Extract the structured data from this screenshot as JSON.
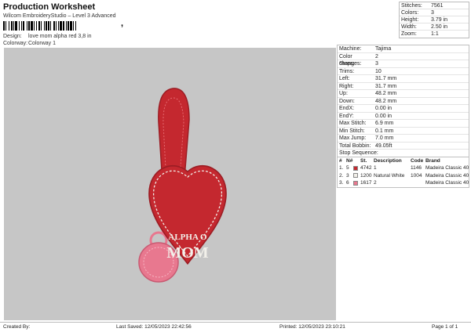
{
  "header": {
    "title": "Production Worksheet",
    "subtitle": "Wilcom EmbroideryStudio – Level 3 Advanced",
    "barcode_suffix": ","
  },
  "meta": [
    {
      "label": "Design:",
      "value": "love mom alpha red 3,8 in"
    },
    {
      "label": "Colorway:",
      "value": "Colorway 1"
    }
  ],
  "summary": [
    {
      "label": "Stitches:",
      "value": "7561"
    },
    {
      "label": "Colors:",
      "value": "3"
    },
    {
      "label": "Height:",
      "value": "3.79 in"
    },
    {
      "label": "Width:",
      "value": "2.50 in"
    },
    {
      "label": "Zoom:",
      "value": "1:1"
    }
  ],
  "machine_info": [
    {
      "label": "Machine:",
      "value": "Tajima"
    },
    {
      "label": "Color changes:",
      "value": "2"
    },
    {
      "label": "Stops:",
      "value": "3"
    },
    {
      "label": "Trims:",
      "value": "10"
    },
    {
      "label": "Left:",
      "value": "31.7 mm"
    },
    {
      "label": "Right:",
      "value": "31.7 mm"
    },
    {
      "label": "Up:",
      "value": "48.2 mm"
    },
    {
      "label": "Down:",
      "value": "48.2 mm"
    },
    {
      "label": "EndX:",
      "value": "0.00 in"
    },
    {
      "label": "EndY:",
      "value": "0.00 in"
    },
    {
      "label": "Max Stitch:",
      "value": "6.9 mm"
    },
    {
      "label": "Min Stitch:",
      "value": "0.1 mm"
    },
    {
      "label": "Max Jump:",
      "value": "7.0 mm"
    },
    {
      "label": "Total Bobbin:",
      "value": "49.05ft"
    }
  ],
  "stop_sequence": {
    "label": "Stop Sequence:",
    "headers": {
      "num": "#",
      "n": "N#",
      "st": "St.",
      "desc": "Description",
      "code": "Code",
      "brand": "Brand"
    },
    "rows": [
      {
        "num": "1.",
        "n": "5",
        "color": "#c4282f",
        "st": "4742",
        "desc": "1",
        "code": "1146",
        "brand": "Madeira Classic 40"
      },
      {
        "num": "2.",
        "n": "3",
        "color": "#f2f0ea",
        "st": "1200",
        "desc": "Natural White",
        "code": "1004",
        "brand": "Madeira Classic 40"
      },
      {
        "num": "3.",
        "n": "6",
        "color": "#e8788f",
        "st": "1617",
        "desc": "2",
        "code": "",
        "brand": "Madeira Classic 40"
      }
    ]
  },
  "design_text": {
    "line1": "ALPHA O",
    "line2": "MOM"
  },
  "colors": {
    "red": "#c4282f",
    "dark_red": "#9c1d24",
    "pink": "#e8788f",
    "white": "#f2f0ea",
    "canvas": "#c6c6c6"
  },
  "footer": {
    "created_by": "Created By:",
    "last_saved": "Last Saved: 12/05/2023 22:42:56",
    "printed": "Printed: 12/05/2023 23:10:21",
    "page": "Page 1 of 1"
  }
}
